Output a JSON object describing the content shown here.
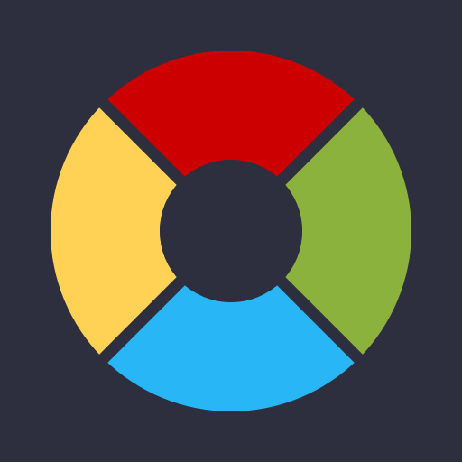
{
  "background_color": "#2e2f3e",
  "icon": {
    "name": "four-color-ring-icon",
    "center_color": "#2e2f3e",
    "gap_color": "#2e2f3e",
    "segments": [
      {
        "name": "top-segment",
        "position": "top",
        "color": "#cc0000"
      },
      {
        "name": "right-segment",
        "position": "right",
        "color": "#8ab23d"
      },
      {
        "name": "bottom-segment",
        "position": "bottom",
        "color": "#29b6f6"
      },
      {
        "name": "left-segment",
        "position": "left",
        "color": "#ffd256"
      }
    ]
  }
}
